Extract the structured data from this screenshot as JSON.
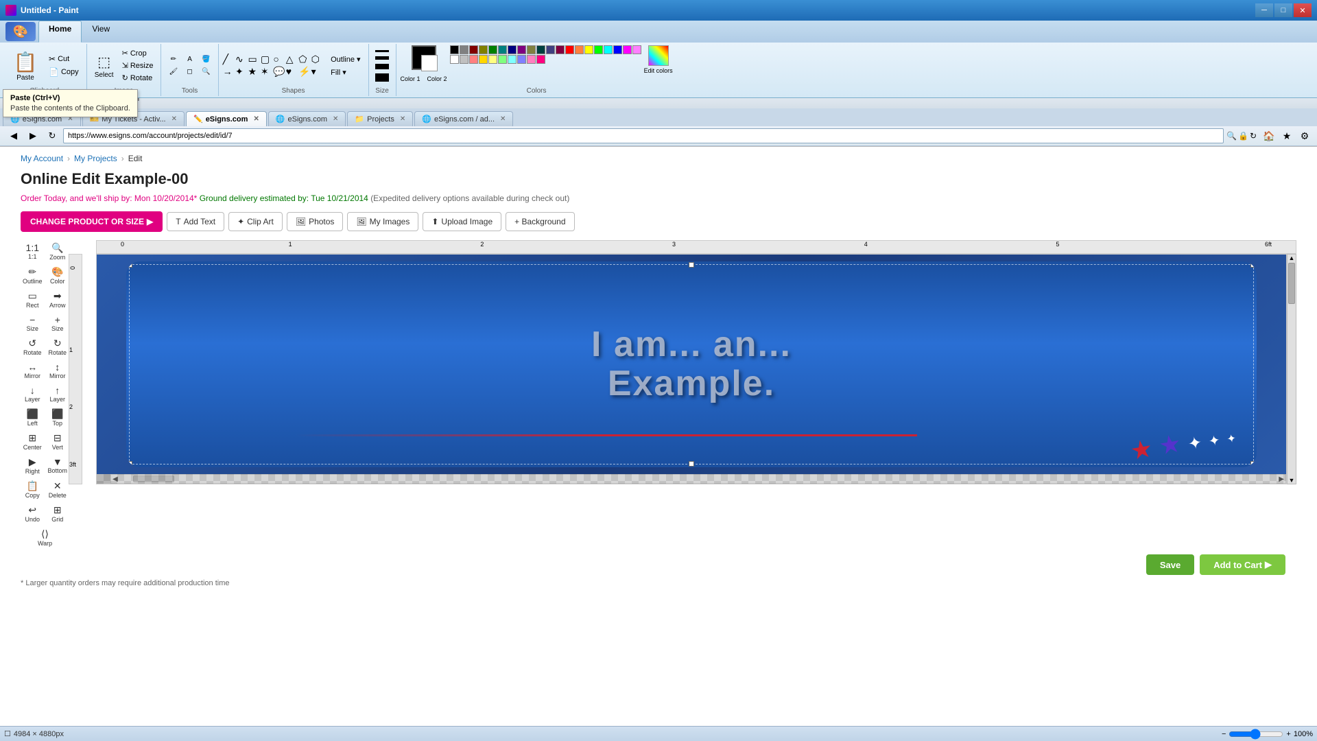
{
  "paint": {
    "title": "Untitled - Paint",
    "tabs": [
      "Home",
      "View"
    ],
    "active_tab": "Home",
    "clipboard": {
      "label": "Clipboard",
      "paste_label": "Paste",
      "cut_label": "Cut",
      "copy_label": "Copy"
    },
    "image": {
      "label": "Image",
      "crop_label": "Crop",
      "resize_label": "Resize",
      "rotate_label": "Rotate",
      "select_label": "Select"
    },
    "tools": {
      "label": "Tools"
    },
    "shapes": {
      "label": "Shapes"
    },
    "colors": {
      "label": "Colors",
      "size_label": "Size",
      "color1_label": "Color 1",
      "color2_label": "Color 2",
      "edit_colors_label": "Edit colors"
    }
  },
  "tooltip": {
    "title": "Paste (Ctrl+V)",
    "description": "Paste the contents of the Clipboard."
  },
  "browser": {
    "tabs": [
      {
        "label": "eSigns.com",
        "active": false,
        "favicon": "🌐"
      },
      {
        "label": "My Tickets - Activ...",
        "active": false,
        "favicon": "🎫"
      },
      {
        "label": "eSigns.com",
        "active": true,
        "favicon": "✏️"
      },
      {
        "label": "eSigns.com",
        "active": false,
        "favicon": "🌐"
      },
      {
        "label": "Projects",
        "active": false,
        "favicon": "📁"
      },
      {
        "label": "eSigns.com / ad...",
        "active": false,
        "favicon": "🌐"
      }
    ],
    "address": "https://www.esigns.com/account/projects/edit/id/7",
    "nav_icons": [
      "◀",
      "▶",
      "↻"
    ],
    "toolbar_icons": [
      "🏠",
      "★",
      "⚙"
    ]
  },
  "page": {
    "breadcrumb": [
      "My Account",
      "My Projects",
      "Edit"
    ],
    "title": "Online Edit Example-00",
    "delivery": {
      "text_prefix": "Order Today, and we'll ship by: Mon 10/20/2014*",
      "text_ground": "Ground delivery estimated by: Tue 10/21/2014",
      "text_suffix": "(Expedited delivery options available during check out)"
    },
    "buttons": {
      "change_product": "CHANGE PRODUCT OR SIZE",
      "add_text": "Add Text",
      "clip_art": "Clip Art",
      "photos": "Photos",
      "my_images": "My Images",
      "upload_image": "Upload Image",
      "background": "+ Background"
    },
    "canvas": {
      "text_line1": "I am... an...",
      "text_line2": "Example.",
      "zoom_label": "Zoom",
      "dimensions": "4984 × 4880px",
      "zoom_level": "100%"
    },
    "editor_tools": [
      {
        "icon": "✏️",
        "label": "Outline"
      },
      {
        "icon": "🎨",
        "label": "Color"
      },
      {
        "icon": "▭",
        "label": "Rect"
      },
      {
        "icon": "➡",
        "label": "Arrow"
      },
      {
        "icon": "−",
        "label": "Size"
      },
      {
        "icon": "+",
        "label": "Size"
      },
      {
        "icon": "↺",
        "label": "Rotate"
      },
      {
        "icon": "↻",
        "label": "Rotate"
      },
      {
        "icon": "↔",
        "label": "Mirror"
      },
      {
        "icon": "↕",
        "label": "Mirror"
      },
      {
        "icon": "↕",
        "label": "Layer"
      },
      {
        "icon": "↑",
        "label": "Layer"
      },
      {
        "icon": "⬛",
        "label": "Left"
      },
      {
        "icon": "⬛",
        "label": "Top"
      },
      {
        "icon": "⬛",
        "label": "Center"
      },
      {
        "icon": "⬛",
        "label": "Vert"
      },
      {
        "icon": "⬛",
        "label": "Right"
      },
      {
        "icon": "⬛",
        "label": "Bottom"
      },
      {
        "icon": "📋",
        "label": "Copy"
      },
      {
        "icon": "✕",
        "label": "Delete"
      },
      {
        "icon": "↩",
        "label": "Undo"
      },
      {
        "icon": "⊞",
        "label": "Grid"
      },
      {
        "icon": "⟨⟩",
        "label": "Warp"
      }
    ],
    "ruler_marks": [
      "0",
      "1",
      "2",
      "3",
      "4",
      "5",
      "6ft"
    ],
    "zoom_in_label": "1:1",
    "zoom_out_label": "Zoom",
    "save_label": "Save",
    "add_to_cart_label": "Add to Cart",
    "footnote": "* Larger quantity orders may require additional production time"
  },
  "status_bar": {
    "dimensions": "4984 × 4880px",
    "zoom": "100%"
  },
  "colors": {
    "swatches": [
      "#000000",
      "#808080",
      "#800000",
      "#808000",
      "#008000",
      "#008080",
      "#000080",
      "#800080",
      "#808040",
      "#004040",
      "#404080",
      "#800040",
      "#ff0000",
      "#ff8040",
      "#ffff00",
      "#00ff00",
      "#00ffff",
      "#0000ff",
      "#ff00ff",
      "#ff80ff",
      "#ffffff",
      "#c0c0c0",
      "#ff8080",
      "#ffd700",
      "#ffff80",
      "#80ff80",
      "#80ffff",
      "#8080ff",
      "#ff80c0",
      "#ff0080"
    ]
  }
}
